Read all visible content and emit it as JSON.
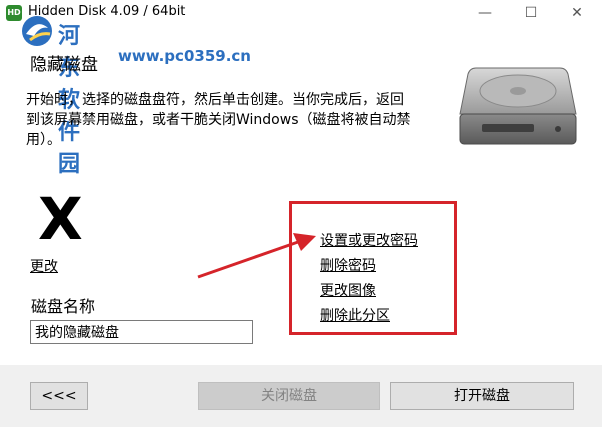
{
  "window": {
    "title": "Hidden Disk 4.09 / 64bit",
    "app_icon_text": "HD",
    "controls": {
      "minimize": "—",
      "maximize": "☐",
      "close": "✕"
    }
  },
  "watermark": {
    "site_name": "河东软件园",
    "url": "www.pc0359.cn"
  },
  "main": {
    "heading": "隐藏磁盘",
    "description": "开始时，选择的磁盘盘符，然后单击创建。当你完成后，返回到该屏幕禁用磁盘，或者干脆关闭Windows（磁盘将被自动禁用）。",
    "drive_letter": "X",
    "change_label": "更改",
    "name_label": "磁盘名称",
    "name_value": "我的隐藏磁盘"
  },
  "links": {
    "set_password": "设置或更改密码",
    "delete_password": "删除密码",
    "change_image": "更改图像",
    "delete_partition": "删除此分区"
  },
  "footer": {
    "back": "<<<",
    "close_disk": "关闭磁盘",
    "open_disk": "打开磁盘"
  },
  "colors": {
    "annotation_red": "#d5242a",
    "watermark_blue": "#2c6fbf"
  }
}
